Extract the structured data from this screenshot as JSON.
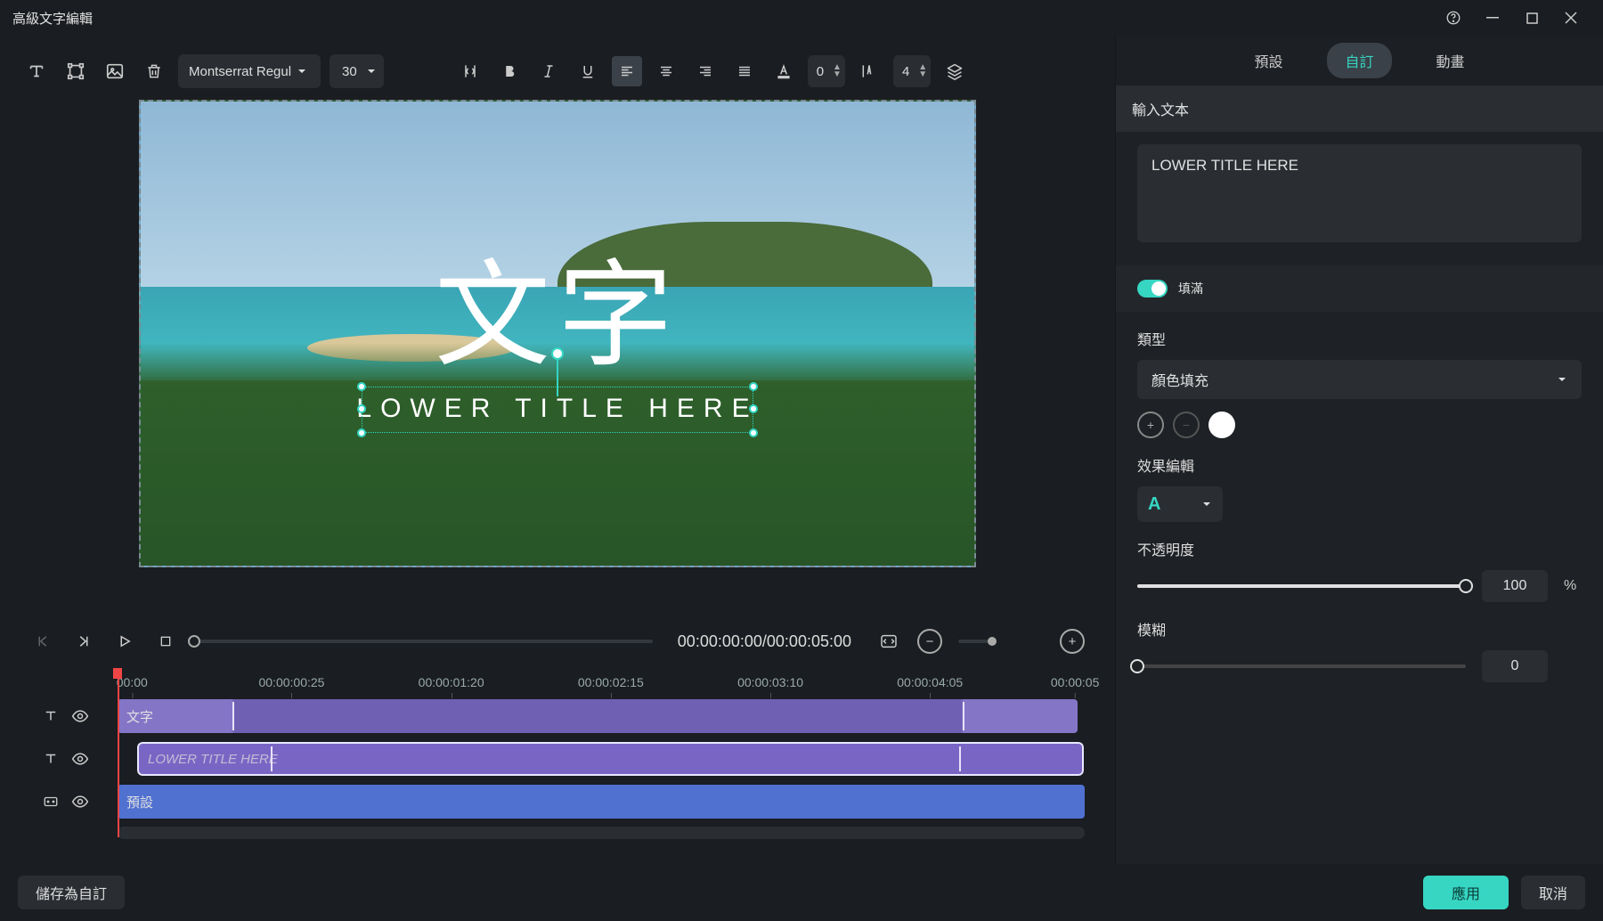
{
  "window": {
    "title": "高級文字編輯"
  },
  "toolbar": {
    "font": "Montserrat Regul",
    "fontSize": "30",
    "letterSpacing": "0",
    "lineHeight": "4"
  },
  "preview": {
    "mainText": "文字",
    "subText": "LOWER TITLE HERE"
  },
  "playback": {
    "current": "00:00:00:00",
    "total": "00:00:05:00"
  },
  "ruler": {
    "ticks": [
      "00:00",
      "00:00:00:25",
      "00:00:01:20",
      "00:00:02:15",
      "00:00:03:10",
      "00:00:04:05",
      "00:00:05"
    ]
  },
  "tracks": [
    {
      "type": "text",
      "label": "文字"
    },
    {
      "type": "text",
      "label": "LOWER TITLE HERE"
    },
    {
      "type": "preset",
      "label": "預設"
    }
  ],
  "tabs": {
    "presets": "預設",
    "custom": "自訂",
    "animation": "動畫"
  },
  "panel": {
    "inputLabel": "輸入文本",
    "textValue": "LOWER TITLE HERE",
    "fillToggle": "填滿",
    "typeLabel": "類型",
    "typeValue": "顏色填充",
    "effectLabel": "效果編輯",
    "effectIcon": "A",
    "opacityLabel": "不透明度",
    "opacityValue": "100",
    "opacityUnit": "%",
    "blurLabel": "模糊",
    "blurValue": "0"
  },
  "footer": {
    "saveCustom": "儲存為自訂",
    "apply": "應用",
    "cancel": "取消"
  }
}
